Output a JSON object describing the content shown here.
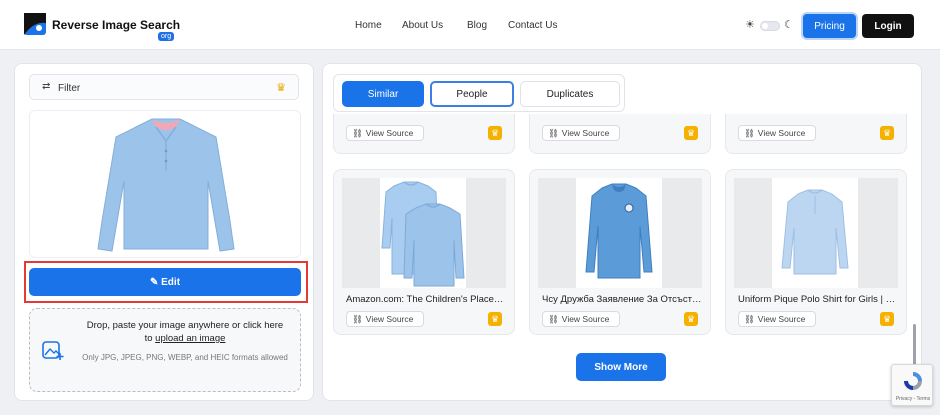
{
  "header": {
    "brand": "Reverse Image Search",
    "brand_badge": "org",
    "nav": [
      {
        "label": "Home"
      },
      {
        "label": "About Us"
      },
      {
        "label": "Blog"
      },
      {
        "label": "Contact Us"
      }
    ],
    "pricing_label": "Pricing",
    "login_label": "Login"
  },
  "left": {
    "filter_label": "Filter",
    "edit_label": "Edit",
    "drop_text_1": "Drop, paste your image anywhere or click here",
    "drop_text_2": "to ",
    "drop_link": "upload an image",
    "drop_note": "Only JPG, JPEG, PNG, WEBP, and HEIC formats allowed"
  },
  "tabs": [
    {
      "label": "Similar",
      "active": true
    },
    {
      "label": "People",
      "active": false
    },
    {
      "label": "Duplicates",
      "active": false
    }
  ],
  "results": {
    "view_source_label": "View Source",
    "cards": [
      {
        "title": "Amazon.com: The Children's Place Boys' Long Sleeve Pique Polo"
      },
      {
        "title": "Чсу Дружба Заявление За Отсъствие"
      },
      {
        "title": "Uniform Pique Polo Shirt for Girls | Old Navy"
      }
    ]
  },
  "show_more_label": "Show More",
  "recaptcha_text": "Privacy - Terms",
  "colors": {
    "accent": "#1a73e8",
    "premium": "#f5b100",
    "highlight": "#e53935",
    "shirt": "#9cc3ea"
  }
}
